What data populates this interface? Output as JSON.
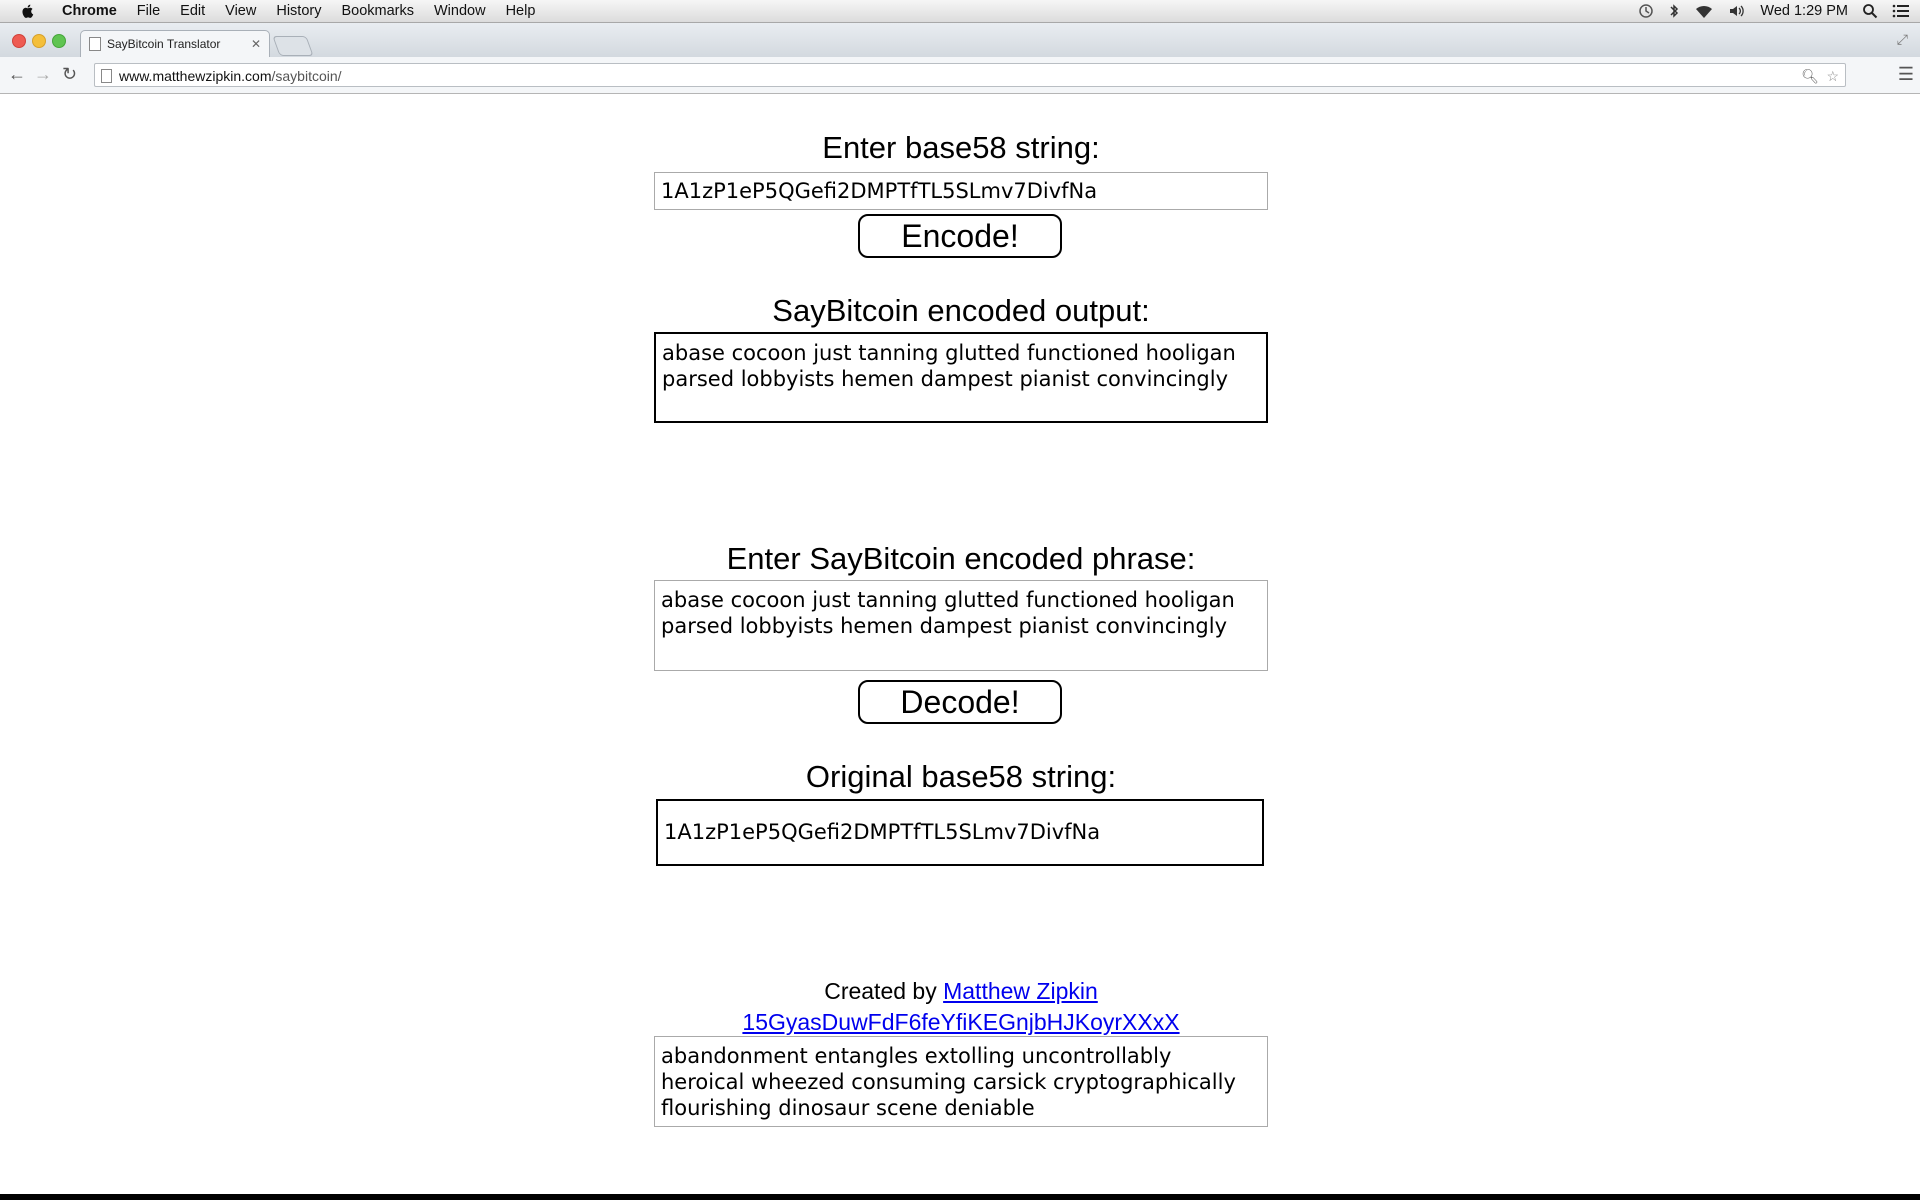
{
  "menubar": {
    "app": "Chrome",
    "items": [
      "File",
      "Edit",
      "View",
      "History",
      "Bookmarks",
      "Window",
      "Help"
    ],
    "clock": "Wed 1:29 PM"
  },
  "browser": {
    "tab_title": "SayBitcoin Translator",
    "url_host": "www.matthewzipkin.com",
    "url_path": "/saybitcoin/"
  },
  "encoder": {
    "heading": "Enter base58 string:",
    "input_value": "1A1zP1eP5QGefi2DMPTfTL5SLmv7DivfNa",
    "button": "Encode!",
    "output_heading": "SayBitcoin encoded output:",
    "output_value": "abase cocoon just tanning glutted functioned hooligan parsed lobbyists hemen dampest pianist convincingly"
  },
  "decoder": {
    "heading": "Enter SayBitcoin encoded phrase:",
    "input_value": "abase cocoon just tanning glutted functioned hooligan parsed lobbyists hemen dampest pianist convincingly",
    "button": "Decode!",
    "output_heading": "Original base58 string:",
    "output_value": "1A1zP1eP5QGefi2DMPTfTL5SLmv7DivfNa"
  },
  "footer": {
    "created_by": "Created by",
    "author": "Matthew Zipkin",
    "address": "15GyasDuwFdF6feYfiKEGnjbHJKoyrXXxX",
    "address_phrase": "abandonment entangles extolling uncontrollably heroical wheezed consuming carsick cryptographically flourishing dinosaur scene deniable"
  }
}
